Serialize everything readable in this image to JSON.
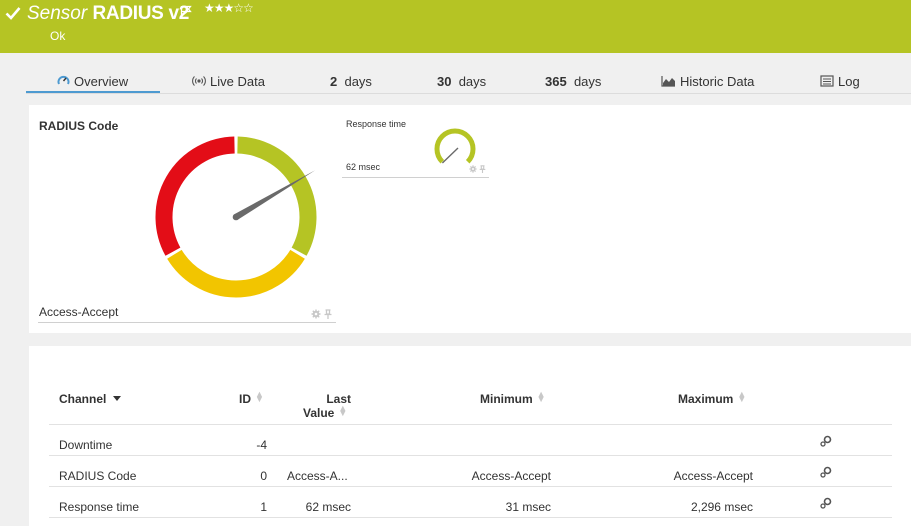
{
  "header": {
    "prefix": "Sensor",
    "name": "RADIUS v2",
    "stars": "★★★☆☆",
    "status": "Ok",
    "bg_color": "#b5c424"
  },
  "tabs": [
    {
      "label": "Overview",
      "icon": "overview-gauge-icon",
      "active": true
    },
    {
      "label": "Live Data",
      "icon": "live-data-icon"
    },
    {
      "num": "2",
      "label": "days"
    },
    {
      "num": "30",
      "label": "days"
    },
    {
      "num": "365",
      "label": "days"
    },
    {
      "label": "Historic Data",
      "icon": "area-chart-icon"
    },
    {
      "label": "Log",
      "icon": "log-list-icon"
    }
  ],
  "gauges": {
    "radius": {
      "title": "RADIUS Code",
      "value": "Access-Accept",
      "needle_fraction": 0.33,
      "colors": {
        "red": "#e30d17",
        "yellow": "#f2c500",
        "green": "#b5c424"
      }
    },
    "response": {
      "title": "Response time",
      "value": "62 msec",
      "needle_fraction": 0.12
    }
  },
  "table": {
    "headers": {
      "channel": "Channel",
      "id": "ID",
      "last_line1": "Last",
      "last_line2": "Value",
      "minimum": "Minimum",
      "maximum": "Maximum"
    },
    "rows": [
      {
        "channel": "Downtime",
        "id": "-4",
        "last": "",
        "min": "",
        "max": ""
      },
      {
        "channel": "RADIUS Code",
        "id": "0",
        "last": "Access-A...",
        "min": "Access-Accept",
        "max": "Access-Accept"
      },
      {
        "channel": "Response time",
        "id": "1",
        "last": "62 msec",
        "min": "31 msec",
        "max": "2,296 msec"
      }
    ]
  }
}
